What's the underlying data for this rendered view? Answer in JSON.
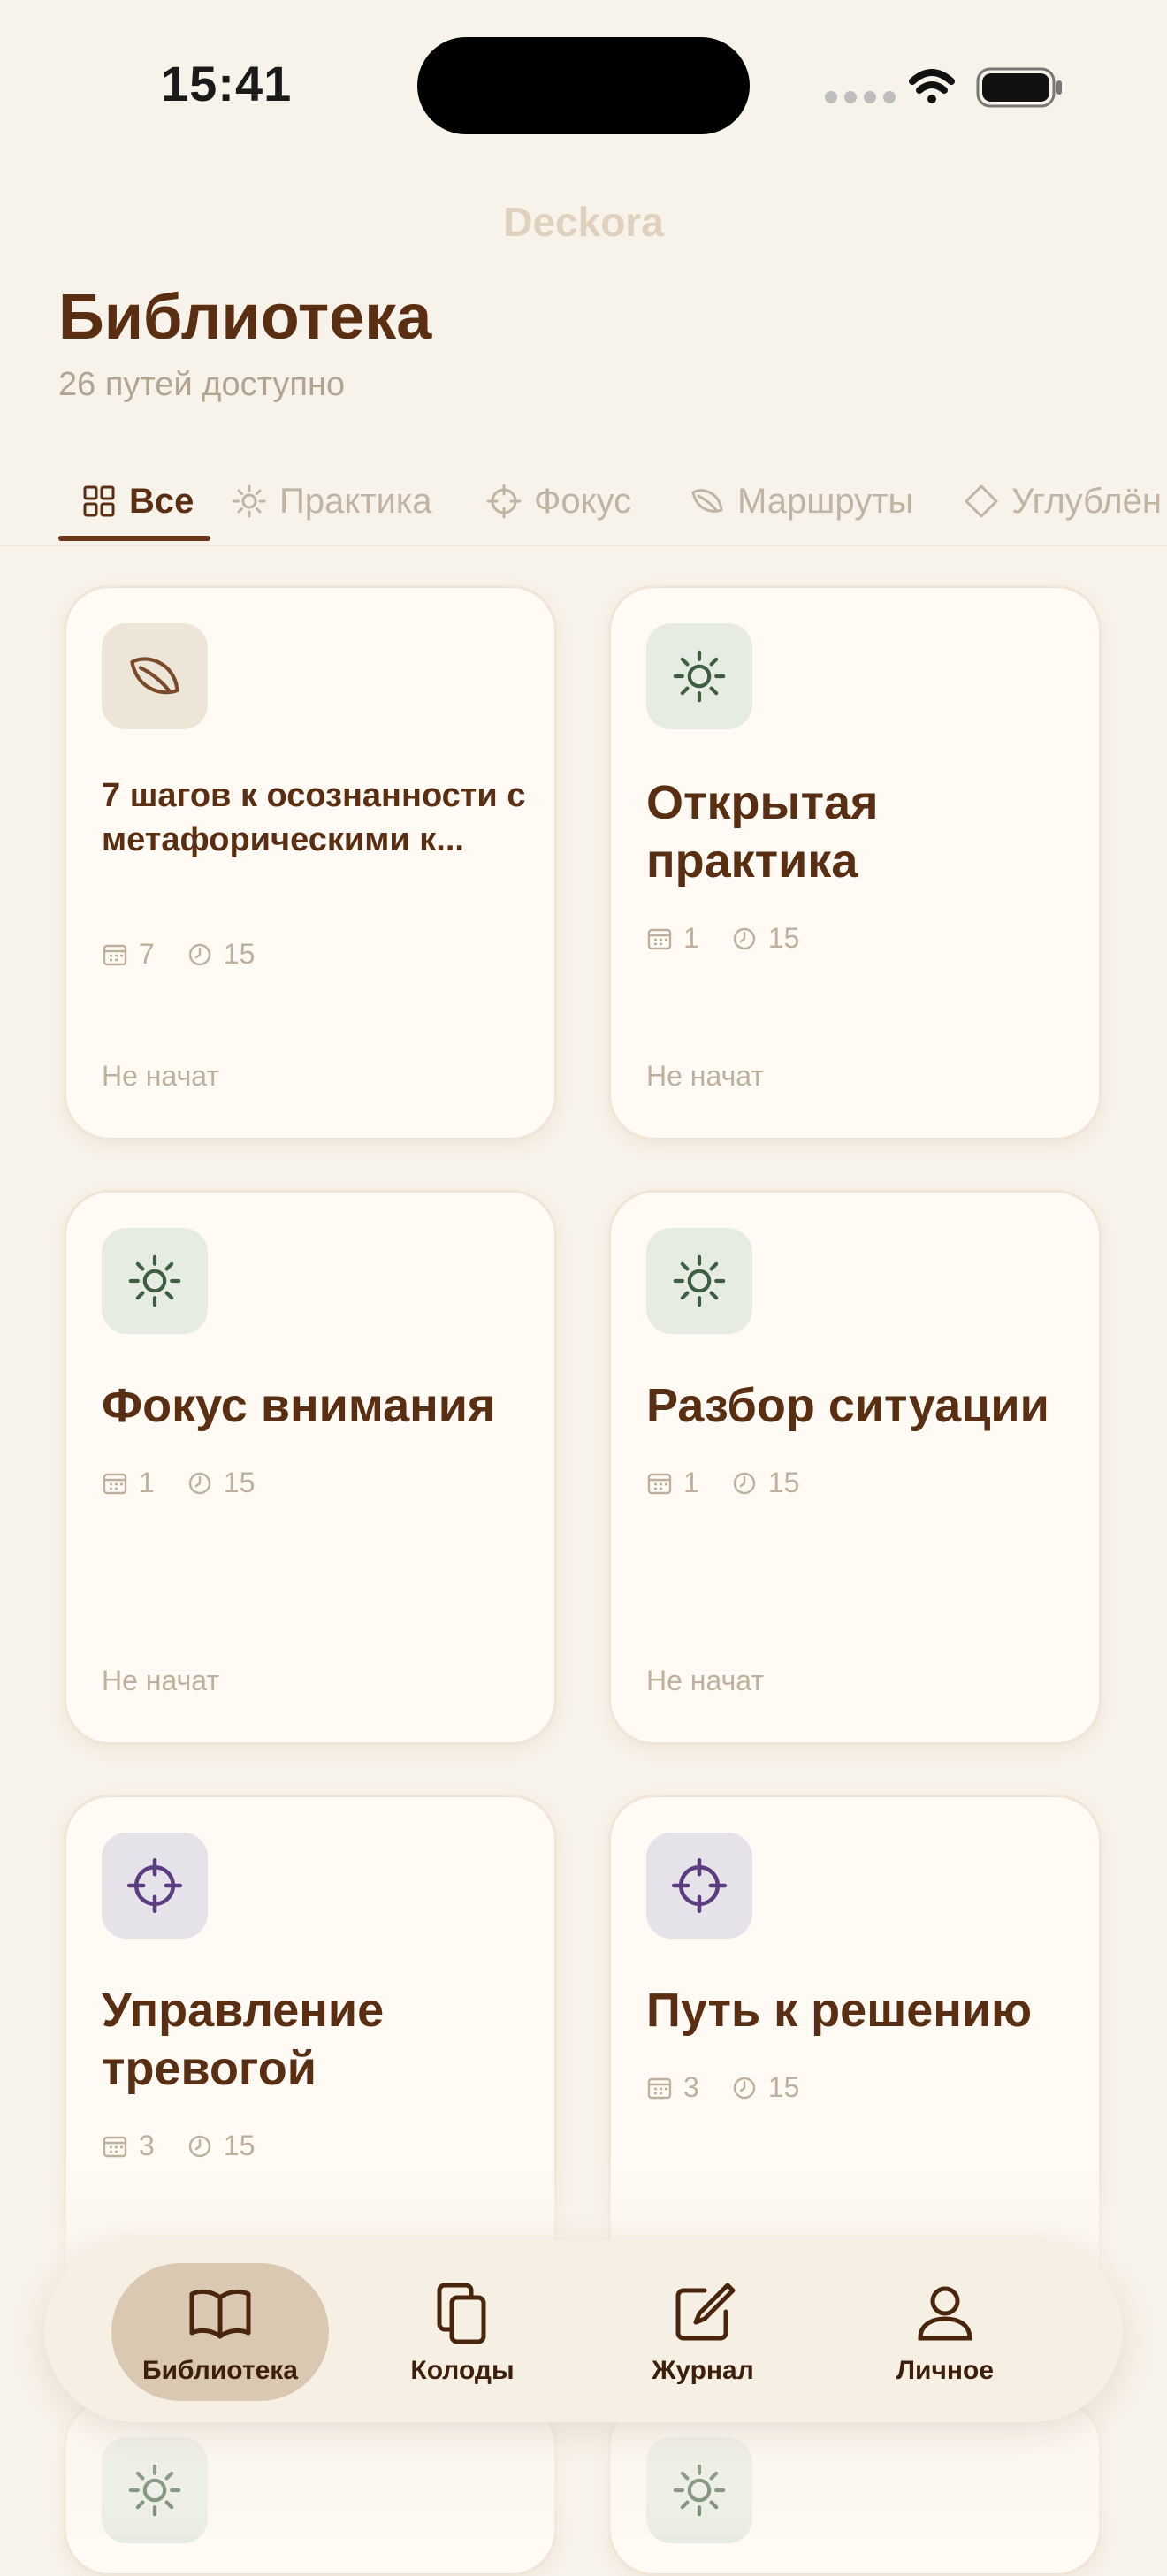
{
  "status_bar": {
    "time": "15:41"
  },
  "app": {
    "name": "Deckora"
  },
  "header": {
    "title": "Библиотека",
    "subtitle": "26 путей доступно"
  },
  "tabs": [
    {
      "label": "Все",
      "icon": "grid-icon",
      "active": true
    },
    {
      "label": "Практика",
      "icon": "sun-icon"
    },
    {
      "label": "Фокус",
      "icon": "crosshair-icon"
    },
    {
      "label": "Маршруты",
      "icon": "leaf-icon"
    },
    {
      "label": "Углублён",
      "icon": "diamond-icon"
    }
  ],
  "cards": [
    {
      "title": "7 шагов к осознанности с метафорическими к...",
      "icon": "leaf-icon",
      "days": "7",
      "minutes": "15",
      "status": "Не начат"
    },
    {
      "title": "Открытая практика",
      "icon": "sun-icon",
      "days": "1",
      "minutes": "15",
      "status": "Не начат"
    },
    {
      "title": "Фокус внимания",
      "icon": "sun-icon",
      "days": "1",
      "minutes": "15",
      "status": "Не начат"
    },
    {
      "title": "Разбор ситуации",
      "icon": "sun-icon",
      "days": "1",
      "minutes": "15",
      "status": "Не начат"
    },
    {
      "title": "Управление тревогой",
      "icon": "crosshair-icon",
      "days": "3",
      "minutes": "15",
      "status": ""
    },
    {
      "title": "Путь к решению",
      "icon": "crosshair-icon",
      "days": "3",
      "minutes": "15",
      "status": ""
    },
    {
      "title": "",
      "icon": "sun-icon"
    },
    {
      "title": "",
      "icon": "sun-icon"
    }
  ],
  "tabbar": [
    {
      "label": "Библиотека",
      "icon": "book-icon",
      "active": true
    },
    {
      "label": "Колоды",
      "icon": "cards-icon"
    },
    {
      "label": "Журнал",
      "icon": "edit-icon"
    },
    {
      "label": "Личное",
      "icon": "person-icon"
    }
  ],
  "colors": {
    "background": "#f8f3ea",
    "card": "#fffbf4",
    "title": "#5a2e12",
    "muted": "#bfb09d",
    "leaf_bg": "#ece5d8",
    "sun_bg": "#e7ece3",
    "sun_icon": "#3d5e3f",
    "target_bg": "#e6e2ea",
    "target_icon": "#5b3c7e",
    "tabbar_active": "#dbc8b3"
  }
}
